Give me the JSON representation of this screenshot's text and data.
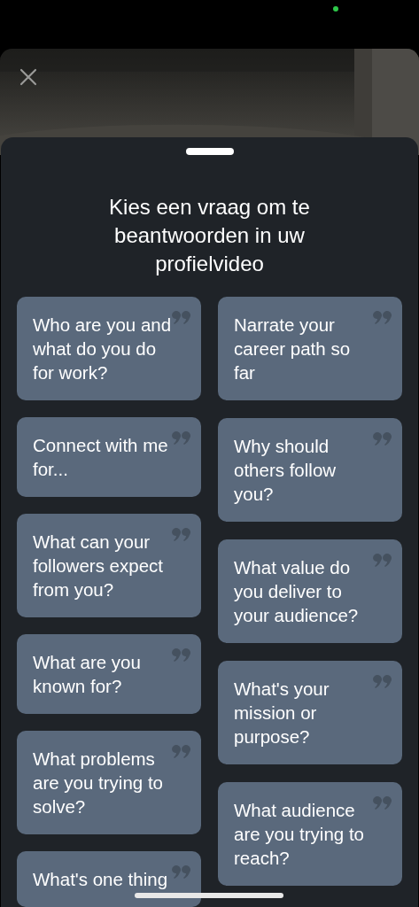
{
  "background": {
    "kind": "picture"
  },
  "title": "Kies een vraag om te beantwoorden in uw profielvideo",
  "columns": [
    [
      {
        "text": "Who are you and what do you do for work?"
      },
      {
        "text": "Connect with me for..."
      },
      {
        "text": "What can your followers expect from you?"
      },
      {
        "text": "What are you known for?"
      },
      {
        "text": "What problems are you trying to solve?"
      },
      {
        "text": "What's one thing"
      }
    ],
    [
      {
        "text": "Narrate your career path so far"
      },
      {
        "text": "Why should others follow you?"
      },
      {
        "text": "What value do you deliver to your audience?"
      },
      {
        "text": "What's your mission or purpose?"
      },
      {
        "text": "What audience are you trying to reach?"
      }
    ]
  ]
}
